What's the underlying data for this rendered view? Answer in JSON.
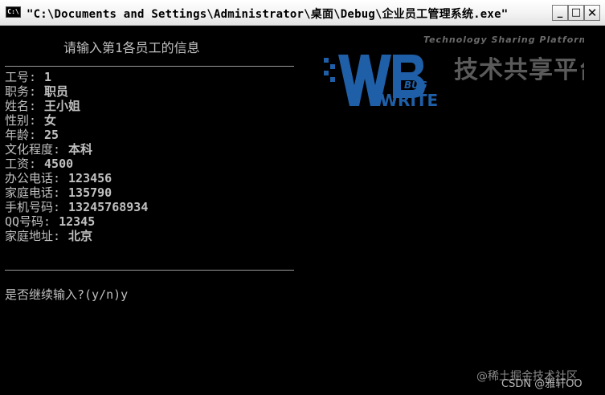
{
  "window": {
    "icon_text": "C:\\",
    "title": "\"C:\\Documents and Settings\\Administrator\\桌面\\Debug\\企业员工管理系统.exe\"",
    "minimize_label": "_",
    "maximize_label": "□",
    "close_label": "✕"
  },
  "console": {
    "heading": "请输入第1各员工的信息",
    "fields": [
      {
        "label": "工号:",
        "value": "1"
      },
      {
        "label": "职务:",
        "value": "职员"
      },
      {
        "label": "姓名:",
        "value": "王小姐"
      },
      {
        "label": "性别:",
        "value": "女"
      },
      {
        "label": "年龄:",
        "value": "25"
      },
      {
        "label": "文化程度:",
        "value": "本科"
      },
      {
        "label": "工资:",
        "value": "4500"
      },
      {
        "label": "办公电话:",
        "value": "123456"
      },
      {
        "label": "家庭电话:",
        "value": "135790"
      },
      {
        "label": "手机号码:",
        "value": "13245768934"
      },
      {
        "label": "QQ号码:",
        "value": "12345"
      },
      {
        "label": "家庭地址:",
        "value": "北京"
      }
    ],
    "prompt": "是否继续输入?(y/n)y"
  },
  "watermark": {
    "logo_text_top": "BUG",
    "logo_text_bottom": "WRITE",
    "tagline": "Technology Sharing Platform",
    "brand_cn": "技术共享平台",
    "footer_1": "@稀土掘金技术社区",
    "footer_2": "CSDN @雅轩OO"
  },
  "colors": {
    "console_bg": "#000000",
    "console_text": "#c0c0c0",
    "watermark_blue": "#1f5fa8"
  }
}
